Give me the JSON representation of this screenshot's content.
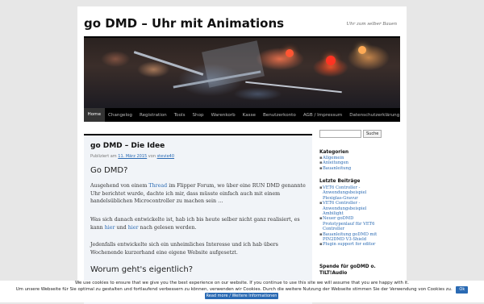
{
  "site": {
    "title": "go DMD – Uhr mit Animations",
    "tagline": "Uhr zum selber Bauen"
  },
  "nav": {
    "items": [
      {
        "label": "Home",
        "active": true
      },
      {
        "label": "Changelog"
      },
      {
        "label": "Registration"
      },
      {
        "label": "Tools"
      },
      {
        "label": "Shop"
      },
      {
        "label": "Warenkorb"
      },
      {
        "label": "Kasse"
      },
      {
        "label": "Benutzerkonto"
      },
      {
        "label": "AGB / Impressum"
      },
      {
        "label": "Datenschutzerklärung"
      }
    ]
  },
  "post": {
    "title": "go DMD – Die Idee",
    "meta_prefix": "Publiziert am",
    "date": "11. März 2015",
    "meta_by": "von",
    "author": "stevie40",
    "h2_1": "Go DMD?",
    "p1_a": "Ausgehend von einem",
    "p1_link": "Thread",
    "p1_b": "im Flipper Forum, wo über eine RUN DMD genannte Uhr berichtet wurde, dachte ich mir, dass müsste einfach auch mit einem handelsüblichen Microcontroller zu machen sein …",
    "p2_a": "Was sich danach entwickelte ist, hab ich bis heute selber nicht ganz realisiert, es kann",
    "p2_link1": "hier",
    "p2_mid": "und",
    "p2_link2": "hier",
    "p2_b": "nach gelesen werden.",
    "p3": "Jedenfalls entwickelte sich ein unheimliches Interesse und ich hab übers Wochenende kurzerhand eine eigene Website aufgesetzt.",
    "h2_2": "Worum geht's eigentlich?"
  },
  "sidebar": {
    "search_button": "Suche",
    "search_value": "",
    "categories_title": "Kategorien",
    "categories": [
      "Allgemein",
      "Anleitungen",
      "Bauanleitung"
    ],
    "recent_title": "Letzte Beiträge",
    "recent": [
      [
        "VET6 Controller -",
        "Anwendungsbeispiel",
        "Plexiglas-Gravur"
      ],
      [
        "VET6 Controller -",
        "Anwendungsbeispiel",
        "Ambilight"
      ],
      [
        "Neuer goDMD",
        "Prototypenlauf für VET6",
        "Controller"
      ],
      [
        "Bauanleitung goDMD mit",
        "PIN2DMD V3-Shield"
      ],
      [
        "Plugin support for editor"
      ]
    ],
    "donate_title": "Spende für goDMD o. TILT!Audio"
  },
  "cookie": {
    "text": "We use cookies to ensure that we give you the best experience on our website. If you continue to use this site we will assume that you are happy with it.",
    "text_de": "Um unsere Webseite für Sie optimal zu gestalten und fortlaufend verbessern zu können, verwenden wir Cookies. Durch die weitere Nutzung der Webseite stimmen Sie der Verwendung von Cookies zu.",
    "ok_label": "Ok",
    "more_label": "Read more / Weitere Informationen"
  },
  "colors": {
    "link": "#2a6ab3",
    "nav_bg": "#000000",
    "content_bg": "#f1f4f8",
    "page_bg": "#e7e7e7"
  }
}
